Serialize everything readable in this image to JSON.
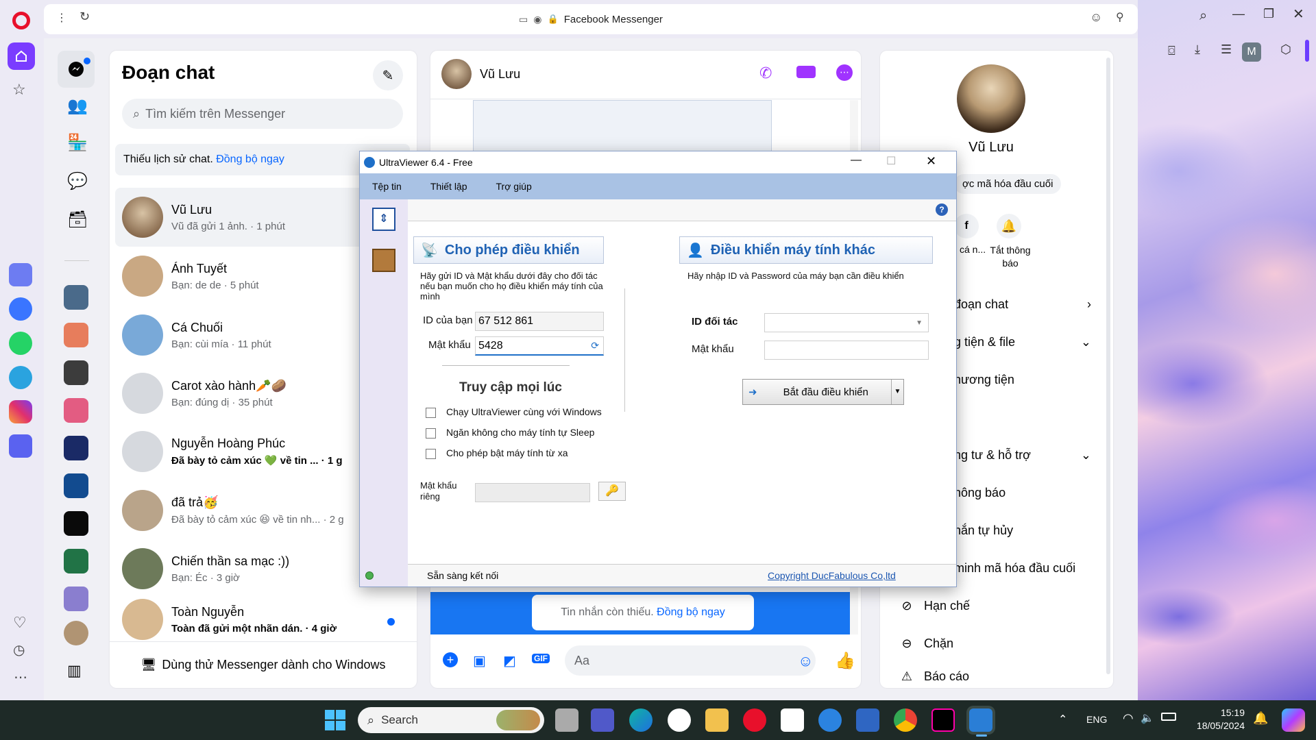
{
  "browser": {
    "tab_title": "Facebook Messenger",
    "profile_initial": "M"
  },
  "messenger": {
    "heading": "Đoạn chat",
    "search_placeholder": "Tìm kiếm trên Messenger",
    "sync_notice": "Thiếu lịch sử chat.",
    "sync_link": "Đồng bộ ngay",
    "try_windows": "Dùng thử Messenger dành cho Windows",
    "chats": [
      {
        "name": "Vũ Lưu",
        "preview": "Vũ đã gửi 1 ảnh. · 1 phút",
        "bold": false
      },
      {
        "name": "Ánh Tuyết",
        "preview": "Bạn: de de · 5 phút",
        "bold": false
      },
      {
        "name": "Cá Chuối",
        "preview": "Bạn: cùi mía · 11 phút",
        "bold": false
      },
      {
        "name": "Carot xào hành🥕🥔",
        "preview": "Bạn: đúng dị · 35 phút",
        "bold": false
      },
      {
        "name": "Nguyễn Hoàng Phúc",
        "preview": "Đã bày tỏ cảm xúc 💚 về tin ... · 1 g",
        "bold": true
      },
      {
        "name": "đã trả🥳",
        "preview": "Đã bày tỏ cảm xúc 😆 về tin nh... · 2 g",
        "bold": false
      },
      {
        "name": "Chiến thần sa mạc :))",
        "preview": "Bạn: Éc · 3 giờ",
        "bold": false
      },
      {
        "name": "Toàn Nguyễn",
        "preview": "Toàn đã gửi một nhãn dán. · 4 giờ",
        "bold": true
      }
    ]
  },
  "conversation": {
    "name": "Vũ Lưu",
    "missing_notice": "Tin nhắn còn thiếu.",
    "missing_link": "Đồng bộ ngay",
    "composer_placeholder": "Aa",
    "accent_color": "#a033ff"
  },
  "info_panel": {
    "name": "Vũ Lưu",
    "encryption_chip": "ợc mã hóa đầu cuối",
    "action_profile": "cá n...",
    "action_mute": "Tắt thông báo",
    "rows": [
      {
        "label": "đoạn chat",
        "chevron": "right"
      },
      {
        "label": "g tiện & file",
        "chevron": "down"
      },
      {
        "label": "hương tiện",
        "chevron": ""
      },
      {
        "label": "ng tư & hỗ trợ",
        "chevron": "down"
      },
      {
        "label": "hông báo",
        "chevron": ""
      },
      {
        "label": "hắn tự hủy",
        "chevron": ""
      },
      {
        "label": "minh mã hóa đầu cuối",
        "chevron": ""
      },
      {
        "label": "Hạn chế",
        "chevron": ""
      },
      {
        "label": "Chặn",
        "chevron": ""
      },
      {
        "label": "Báo cáo",
        "chevron": ""
      }
    ]
  },
  "ultraviewer": {
    "title": "UltraViewer 6.4 - Free",
    "menu": [
      "Tệp tin",
      "Thiết lập",
      "Trợ giúp"
    ],
    "allow_heading": "Cho phép điều khiển",
    "allow_desc": "Hãy gửi ID và Mật khẩu dưới đây cho đối tác nếu bạn muốn cho họ điều khiển máy tính của mình",
    "your_id_label": "ID của bạn",
    "your_id_value": "67 512 861",
    "password_label": "Mật khẩu",
    "password_value": "5428",
    "access_heading": "Truy cập mọi lúc",
    "options": [
      "Chạy UltraViewer cùng với Windows",
      "Ngăn không cho máy tính tự Sleep",
      "Cho phép bật máy tính từ xa"
    ],
    "private_pw_label": "Mật khẩu riêng",
    "control_heading": "Điều khiển máy tính khác",
    "control_desc": "Hãy nhập ID và Password của máy bạn cần điều khiển",
    "partner_id_label": "ID đối tác",
    "partner_pw_label": "Mật khẩu",
    "start_button": "Bắt đầu điều khiển",
    "status": "Sẵn sàng kết nối",
    "copyright": "Copyright DucFabulous Co,ltd"
  },
  "taskbar": {
    "search_label": "Search",
    "language": "ENG",
    "time": "15:19",
    "date": "18/05/2024"
  }
}
